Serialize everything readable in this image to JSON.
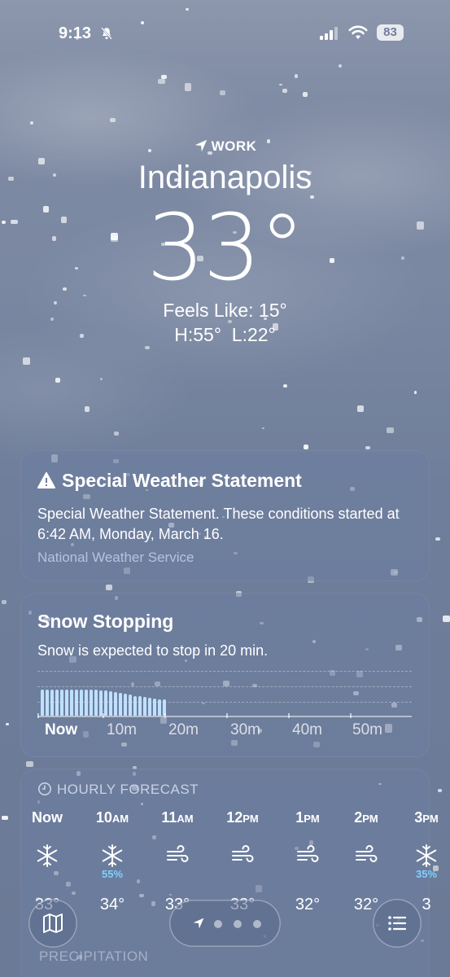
{
  "status_bar": {
    "time": "9:13",
    "battery": "83",
    "icons": [
      "bell-slash-icon",
      "cellular-signal-icon",
      "wifi-icon",
      "battery-icon"
    ]
  },
  "location": {
    "tag": "WORK",
    "city": "Indianapolis",
    "temperature": "33°",
    "feels_like": "Feels Like: 15°",
    "high_low": "H:55°  L:22°"
  },
  "alert_card": {
    "title": "Special Weather Statement",
    "body": "Special Weather Statement. These conditions started at 6:42 AM, Monday, March 16.",
    "source": "National Weather Service",
    "icon": "warning-triangle-icon"
  },
  "precip_card": {
    "title": "Snow Stopping",
    "subtitle": "Snow is expected to stop in 20 min.",
    "time_labels": [
      "Now",
      "10m",
      "20m",
      "30m",
      "40m",
      "50m"
    ],
    "intensity": [
      0.95,
      0.95,
      0.95,
      0.95,
      0.95,
      0.95,
      0.95,
      0.95,
      0.95,
      0.95,
      0.95,
      0.93,
      0.92,
      0.9,
      0.88,
      0.85,
      0.82,
      0.78,
      0.75,
      0.72,
      0.7,
      0.68,
      0.65,
      0.62,
      0.6,
      0.58,
      0.0
    ],
    "colors": {
      "bar": "#bfe0ff"
    }
  },
  "hourly_card": {
    "header": "HOURLY FORECAST",
    "hours": [
      {
        "label": "Now",
        "suffix": "",
        "icon": "snowflake-icon",
        "pct": "",
        "temp": "33°"
      },
      {
        "label": "10",
        "suffix": "AM",
        "icon": "snowflake-icon",
        "pct": "55%",
        "temp": "34°"
      },
      {
        "label": "11",
        "suffix": "AM",
        "icon": "wind-icon",
        "pct": "",
        "temp": "33°"
      },
      {
        "label": "12",
        "suffix": "PM",
        "icon": "wind-icon",
        "pct": "",
        "temp": "33°"
      },
      {
        "label": "1",
        "suffix": "PM",
        "icon": "wind-icon",
        "pct": "",
        "temp": "32°"
      },
      {
        "label": "2",
        "suffix": "PM",
        "icon": "wind-icon",
        "pct": "",
        "temp": "32°"
      },
      {
        "label": "3",
        "suffix": "PM",
        "icon": "snowflake-icon",
        "pct": "35%",
        "temp": "3"
      }
    ]
  },
  "bottom_bar": {
    "map_icon": "map-icon",
    "list_icon": "list-icon",
    "next_section": "PRECIPITATION"
  }
}
